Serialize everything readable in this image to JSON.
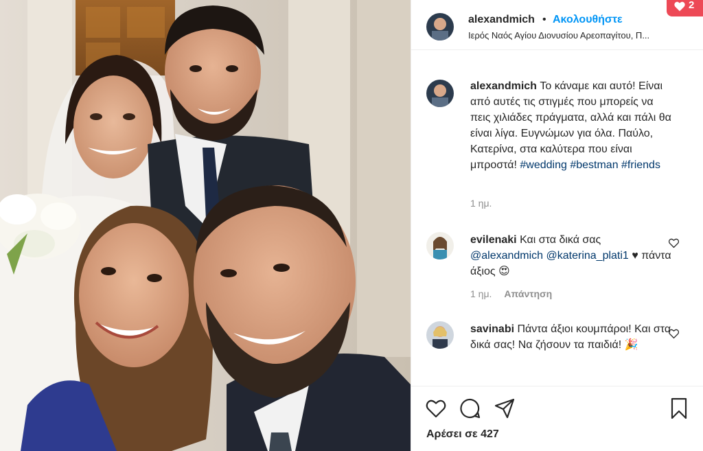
{
  "post": {
    "username": "alexandmich",
    "separator": "•",
    "follow_label": "Ακολουθήστε",
    "location": "Ιερός Ναός Αγίου Διονυσίου Αρεοπαγίτου, Π...",
    "more_label": "•••",
    "notification_count": "2"
  },
  "caption": {
    "username": "alexandmich",
    "text": "Το κάναμε και αυτό! Είναι από αυτές τις στιγμές που μπορείς να πεις χιλιάδες πράγματα, αλλά και πάλι θα είναι λίγα. Ευγνώμων για όλα. Παύλο, Κατερίνα, στα καλύτερα που είναι μπροστά! ",
    "hashtags": "#wedding #bestman #friends",
    "time": "1 ημ."
  },
  "comments": [
    {
      "username": "evilenaki",
      "text_before": "Και στα δικά σας ",
      "mentions": "@alexandmich @katerina_plati1",
      "text_after": " ♥ πάντα άξιος 😍",
      "time": "1 ημ.",
      "reply_label": "Απάντηση"
    },
    {
      "username": "savinabi",
      "text": "Πάντα άξιοι κουμπάροι! Και στα δικά σας! Να ζήσουν τα παιδιά! 🎉"
    }
  ],
  "likes_label": "Αρέσει σε 427",
  "colors": {
    "accent": "#0095f6",
    "notification": "#ed4956",
    "mention": "#00376b",
    "muted": "#8e8e8e"
  }
}
